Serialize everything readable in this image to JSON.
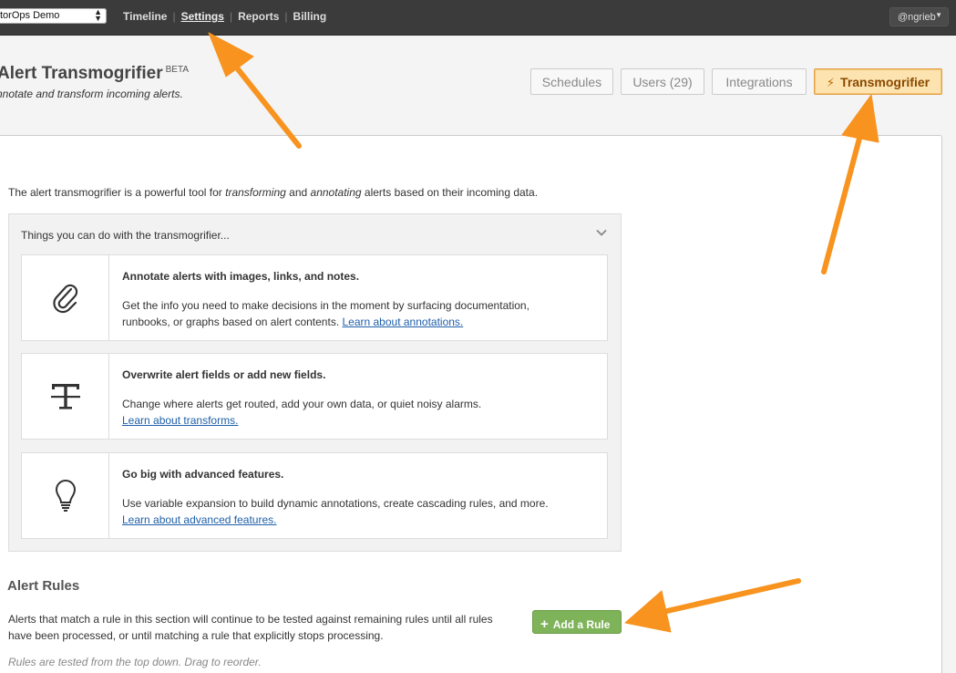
{
  "topbar": {
    "org_name": "torOps Demo",
    "nav": [
      "Timeline",
      "Settings",
      "Reports",
      "Billing"
    ],
    "active_nav": "Settings",
    "user": "@ngrieb"
  },
  "header": {
    "title": "Alert Transmogrifier",
    "badge": "BETA",
    "subtitle": "nnotate and transform incoming alerts."
  },
  "tabs": [
    {
      "label": "Schedules"
    },
    {
      "label": "Users (29)"
    },
    {
      "label": "Integrations"
    },
    {
      "label": "Transmogrifier",
      "icon": "magic-wand-icon"
    }
  ],
  "intro": {
    "part1": "The alert transmogrifier is a powerful tool for ",
    "em1": "transforming",
    "part2": " and ",
    "em2": "annotating",
    "part3": " alerts based on their incoming data."
  },
  "panel": {
    "heading": "Things you can do with the transmogrifier...",
    "features": [
      {
        "icon": "paperclip-icon",
        "title": "Annotate alerts with images, links, and notes.",
        "desc": "Get the info you need to make decisions in the moment by surfacing documentation, runbooks, or graphs based on alert contents. ",
        "link": "Learn about annotations."
      },
      {
        "icon": "text-transform-icon",
        "title": "Overwrite alert fields or add new fields.",
        "desc": "Change where alerts get routed, add your own data, or quiet noisy alarms.",
        "link": "Learn about transforms."
      },
      {
        "icon": "lightbulb-icon",
        "title": "Go big with advanced features.",
        "desc": "Use variable expansion to build dynamic annotations, create cascading rules, and more.",
        "link": "Learn about advanced features."
      }
    ]
  },
  "rules": {
    "title": "Alert Rules",
    "desc": "Alerts that match a rule in this section will continue to be tested against remaining rules until all rules have been processed, or until matching a rule that explicitly stops processing.",
    "note": "Rules are tested from the top down. Drag to reorder.",
    "add_button": "Add a Rule"
  },
  "colors": {
    "topbar": "#3b3b3b",
    "active_tab_bg": "#fce3b0",
    "add_button": "#7fb35a",
    "annotation_arrow": "#f7931e",
    "link": "#1f5fa8"
  }
}
